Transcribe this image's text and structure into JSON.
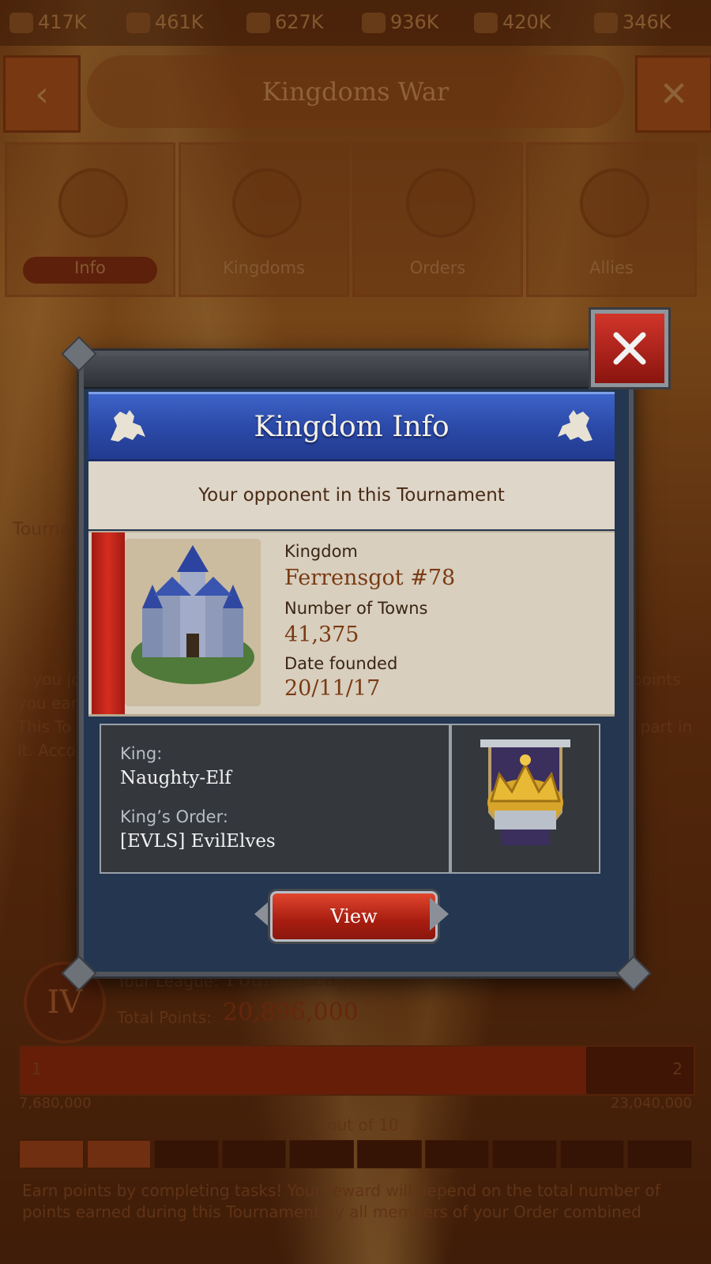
{
  "resources": [
    {
      "icon": "food-icon",
      "value": "417K"
    },
    {
      "icon": "wood-icon",
      "value": "461K"
    },
    {
      "icon": "stone-icon",
      "value": "627K"
    },
    {
      "icon": "iron-icon",
      "value": "936K"
    },
    {
      "icon": "silver-icon",
      "value": "420K"
    },
    {
      "icon": "gold-icon",
      "value": "346K"
    }
  ],
  "window": {
    "title": "Kingdoms War",
    "back_icon": "back-arrow-icon",
    "close_icon": "close-icon"
  },
  "nav_tabs": [
    {
      "label": "Info",
      "icon": "info-icon",
      "active": true
    },
    {
      "label": "Kingdoms",
      "icon": "kingdoms-icon",
      "active": false
    },
    {
      "label": "Orders",
      "icon": "orders-icon",
      "active": false
    },
    {
      "label": "Allies",
      "icon": "allies-icon",
      "active": false
    }
  ],
  "background": {
    "tournament_label": "Tourna",
    "desc_left_1": "If you jo",
    "desc_left_2": "you ear",
    "desc_left_3": "This To",
    "desc_left_4": "it. Acco",
    "desc_right_1": "points",
    "desc_right_3": "e part in",
    "league_badge": "IV",
    "league_label": "Your League:",
    "league_value": "Fourth League",
    "points_label": "Total Points:",
    "points_value": "20,896,000",
    "progress_start_step": "1",
    "progress_end_step": "2",
    "progress_min": "7,680,000",
    "progress_max": "23,040,000",
    "progress_fraction": 0.84,
    "steps_text": "2 out of 10",
    "steps_done": 2,
    "steps_total": 10,
    "footer_text": "Earn points by completing tasks! Your reward will depend on the total number of points earned during this Tournament by all members of your Order combined"
  },
  "modal": {
    "title": "Kingdom Info",
    "subtitle": "Your opponent in this Tournament",
    "kingdom_label": "Kingdom",
    "kingdom_name": "Ferrensgot #78",
    "towns_label": "Number of Towns",
    "towns_value": "41,375",
    "founded_label": "Date founded",
    "founded_value": "20/11/17",
    "king_label": "King:",
    "king_name": "Naughty-Elf",
    "order_label": "King’s Order:",
    "order_name": "[EVLS] EvilElves",
    "view_button": "View",
    "thumbnail_icon": "castle-icon",
    "crest_icon": "crown-crest-icon"
  },
  "colors": {
    "banner_blue": "#2a48a6",
    "parchment": "#ded6c8",
    "value_brown": "#7a3a12",
    "button_red": "#c0281a",
    "panel_dark": "#34373c"
  }
}
